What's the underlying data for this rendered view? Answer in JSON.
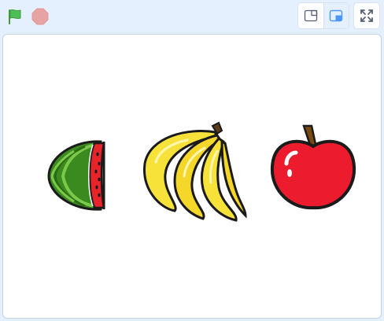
{
  "toolbar": {
    "green_flag": {
      "icon": "green-flag-icon",
      "color": "#4cbf56"
    },
    "stop": {
      "icon": "stop-sign-icon",
      "color": "#e6a3a3"
    },
    "layout_small_stage": {
      "icon": "small-stage-icon"
    },
    "layout_normal_stage": {
      "icon": "normal-stage-icon",
      "accent": "#4c97ff"
    },
    "fullscreen": {
      "icon": "fullscreen-icon"
    }
  },
  "stage": {
    "sprites": [
      {
        "name": "watermelon",
        "icon": "watermelon-icon",
        "colors": [
          "#3a8a1f",
          "#e8242b"
        ]
      },
      {
        "name": "bananas",
        "icon": "bananas-icon",
        "colors": [
          "#f7e23a"
        ]
      },
      {
        "name": "apple",
        "icon": "apple-icon",
        "colors": [
          "#ec1c2e",
          "#7a4a12"
        ]
      }
    ]
  }
}
